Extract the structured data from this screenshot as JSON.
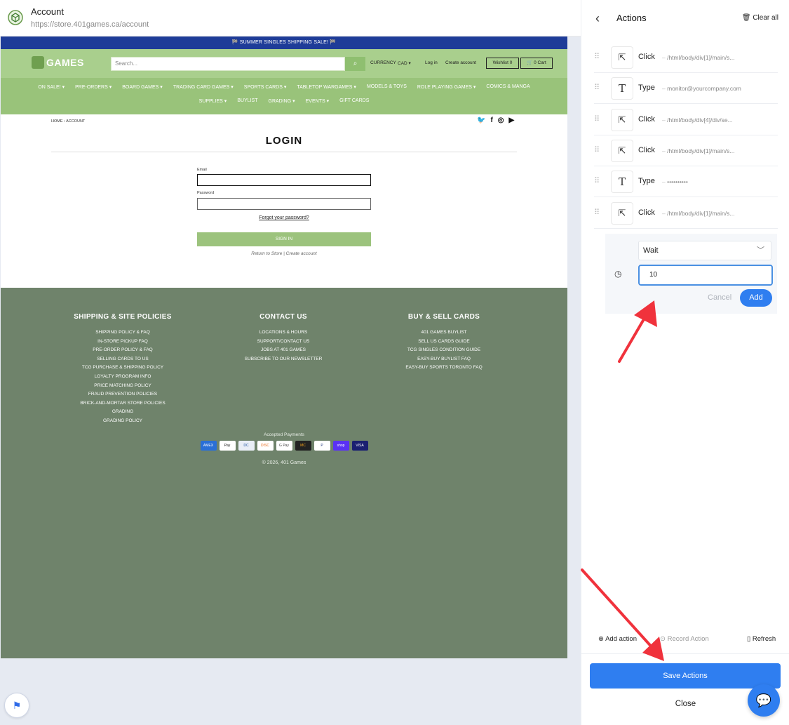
{
  "window": {
    "title": "Account",
    "url": "https://store.401games.ca/account"
  },
  "site": {
    "announcement": "🏁 SUMMER SINGLES SHIPPING SALE! 🏁",
    "brand": "GAMES",
    "search_placeholder": "Search...",
    "currency_label": "CURRENCY",
    "currency_value": "CAD ▾",
    "login_link": "Log in",
    "create_account_link": "Create account",
    "wishlist": "Wishlist 0",
    "cart": "🛒 0 Cart",
    "nav_row1": [
      "ON SALE! ▾",
      "PRE-ORDERS ▾",
      "BOARD GAMES ▾",
      "TRADING CARD GAMES ▾",
      "SPORTS CARDS ▾",
      "TABLETOP WARGAMES ▾",
      "MODELS & TOYS",
      "ROLE PLAYING GAMES ▾",
      "COMICS & MANGA"
    ],
    "nav_row2": [
      "SUPPLIES ▾",
      "BUYLIST",
      "GRADING ▾",
      "EVENTS ▾",
      "GIFT CARDS"
    ],
    "breadcrumb": "HOME › ACCOUNT",
    "login_title": "LOGIN",
    "email_label": "Email",
    "password_label": "Password",
    "forgot_link": "Forgot your password?",
    "signin_button": "SIGN IN",
    "return_links": "Return to Store | Create account",
    "footer": {
      "col1_title": "SHIPPING & SITE POLICIES",
      "col1": [
        "SHIPPING POLICY & FAQ",
        "IN-STORE PICKUP FAQ",
        "PRE-ORDER POLICY & FAQ",
        "SELLING CARDS TO US",
        "TCG PURCHASE & SHIPPING POLICY",
        "LOYALTY PROGRAM INFO",
        "PRICE MATCHING POLICY",
        "FRAUD PREVENTION POLICIES",
        "BRICK-AND-MORTAR STORE POLICIES",
        "GRADING",
        "GRADING POLICY"
      ],
      "col2_title": "CONTACT US",
      "col2": [
        "LOCATIONS & HOURS",
        "SUPPORT/CONTACT US",
        "JOBS AT 401 GAMES",
        "SUBSCRIBE TO OUR NEWSLETTER"
      ],
      "col3_title": "BUY & SELL CARDS",
      "col3": [
        "401 GAMES BUYLIST",
        "SELL US CARDS GUIDE",
        "TCG SINGLES CONDITION GUIDE",
        "EASY-BUY BUYLIST FAQ",
        "EASY-BUY SPORTS TORONTO FAQ"
      ],
      "payments_label": "Accepted Payments",
      "payments": [
        "AMEX",
        "Pay",
        "DC",
        "DISC",
        "G Pay",
        "MC",
        "P",
        "shop",
        "VISA"
      ],
      "copyright": "© 2026, 401 Games"
    }
  },
  "panel": {
    "title": "Actions",
    "clear_all": "Clear all",
    "actions": [
      {
        "type": "Click",
        "detail": "/html/body/div[1]/main/s..."
      },
      {
        "type": "Type",
        "detail": "monitor@yourcompany.com"
      },
      {
        "type": "Click",
        "detail": "/html/body/div[4]/div/se..."
      },
      {
        "type": "Click",
        "detail": "/html/body/div[1]/main/s..."
      },
      {
        "type": "Type",
        "detail": "••••••••••"
      },
      {
        "type": "Click",
        "detail": "/html/body/div[1]/main/s..."
      }
    ],
    "new_action": {
      "selected": "Wait",
      "value": "10",
      "cancel": "Cancel",
      "add": "Add"
    },
    "add_action": "Add action",
    "record_action": "Record Action",
    "refresh": "Refresh",
    "save": "Save Actions",
    "close": "Close"
  },
  "colors": {
    "accent": "#2f7ef0",
    "site_green": "#a9cf8d",
    "footer": "#6f836b",
    "annotation": "#f0323c"
  }
}
